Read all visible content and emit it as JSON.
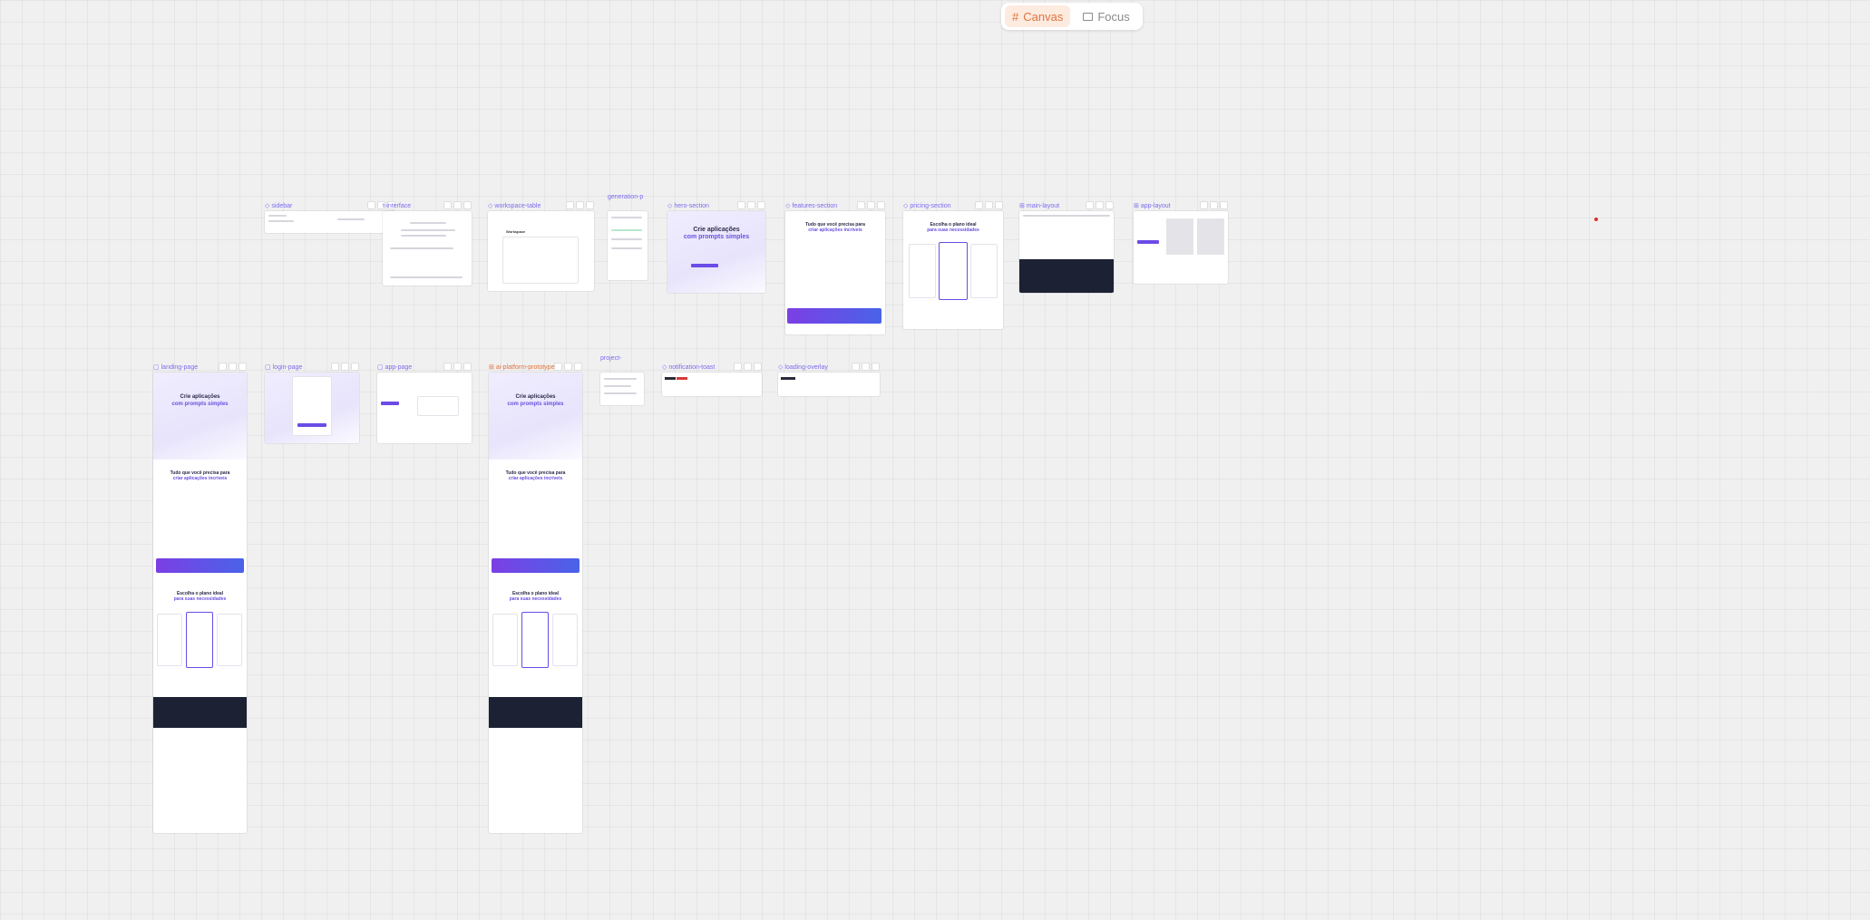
{
  "view_toggle": {
    "canvas_label": "Canvas",
    "focus_label": "Focus",
    "active": "Canvas",
    "accent_color": "#e2733d"
  },
  "frames": {
    "sidebar": "sidebar",
    "interface": "t-interface",
    "workspace": "workspace-table",
    "generation": "generation-p",
    "hero": "hero-section",
    "features": "features-section",
    "pricing": "pricing-section",
    "main_layout": "main-layout",
    "app_layout": "app-layout",
    "landing": "landing-page",
    "login": "login-page",
    "app_page": "app-page",
    "ai_platform": "ai-platform-prototype",
    "project": "project-",
    "notification": "notification-toast",
    "loading": "loading-overlay"
  },
  "hero": {
    "title_line1": "Crie aplicações",
    "title_line2": "com prompts simples"
  },
  "features": {
    "title_line1": "Tudo que você precisa para",
    "title_line2": "criar aplicações incríveis"
  },
  "pricing": {
    "title_line1": "Escolha o plano ideal",
    "title_line2": "para suas necessidades"
  },
  "workspace": {
    "heading": "Workspace"
  },
  "colors": {
    "frame_label": "#7b6cf0",
    "brand": "#6b4ce6",
    "footer": "#1c2233"
  }
}
